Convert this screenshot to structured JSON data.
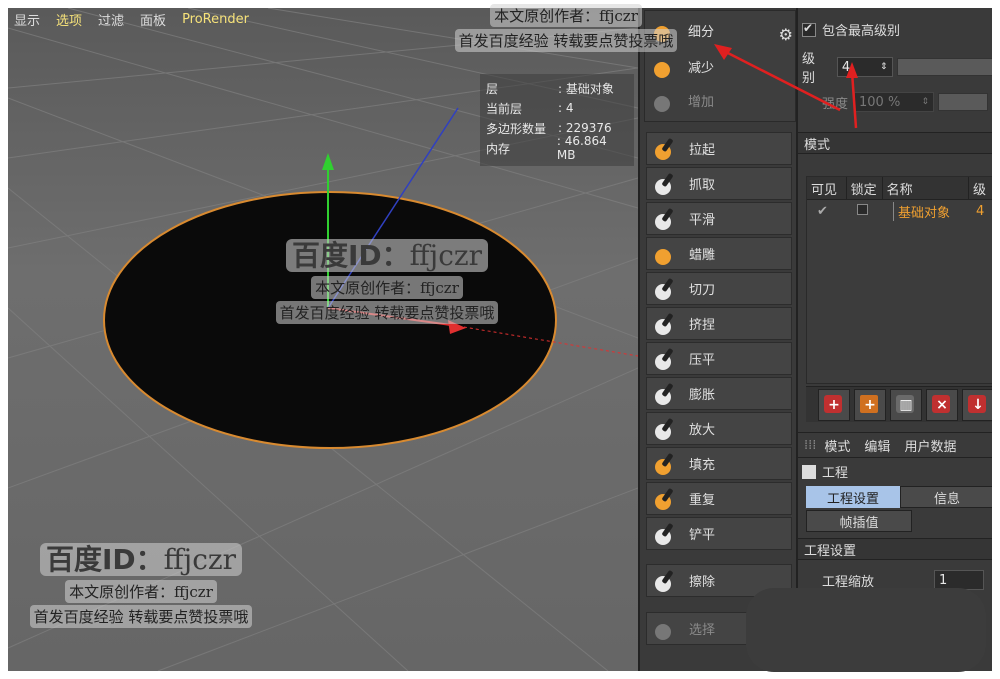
{
  "viewport": {
    "menu": [
      "显示",
      "选项",
      "过滤",
      "面板",
      "ProRender"
    ],
    "hud": [
      {
        "k": "层",
        "v": ": 基础对象"
      },
      {
        "k": "当前层",
        "v": ": 4"
      },
      {
        "k": "多边形数量",
        "v": ": 229376"
      },
      {
        "k": "内存",
        "v": ": 46.864 MB"
      }
    ]
  },
  "watermark": {
    "id_label": "百度ID：",
    "id_name": "ffjczr",
    "line1": "本文原创作者：ffjczr",
    "line2": "首发百度经验 转载要点赞投票哦"
  },
  "tools": {
    "top": [
      {
        "label": "细分"
      },
      {
        "label": "减少"
      },
      {
        "label": "增加"
      }
    ],
    "brushes": [
      {
        "label": "拉起"
      },
      {
        "label": "抓取"
      },
      {
        "label": "平滑"
      },
      {
        "label": "蜡雕"
      },
      {
        "label": "切刀"
      },
      {
        "label": "挤捏"
      },
      {
        "label": "压平"
      },
      {
        "label": "膨胀"
      },
      {
        "label": "放大"
      },
      {
        "label": "填充"
      },
      {
        "label": "重复"
      },
      {
        "label": "铲平"
      }
    ],
    "erase": "擦除",
    "select": "选择"
  },
  "rpanel": {
    "include_highest": "包含最高级别",
    "level_label": "级别",
    "level_value": "4",
    "strength_label": "强度",
    "strength_value": "100 %",
    "mode_header": "模式",
    "columns": [
      "可见",
      "锁定",
      "名称",
      "级"
    ],
    "row": {
      "name": "基础对象",
      "level": "4"
    },
    "menu": [
      "模式",
      "编辑",
      "用户数据"
    ],
    "project_title": "工程",
    "tab_active": "工程设置",
    "tab_info": "信息",
    "tab_interp": "帧插值",
    "section": "工程设置",
    "field_label": "工程缩放",
    "field_value": "1"
  },
  "colors": {
    "accent_yellow": "#f6e27a",
    "orange": "#f0a030",
    "tab_blue": "#a8c4e8",
    "arrow_red": "#e02020"
  }
}
